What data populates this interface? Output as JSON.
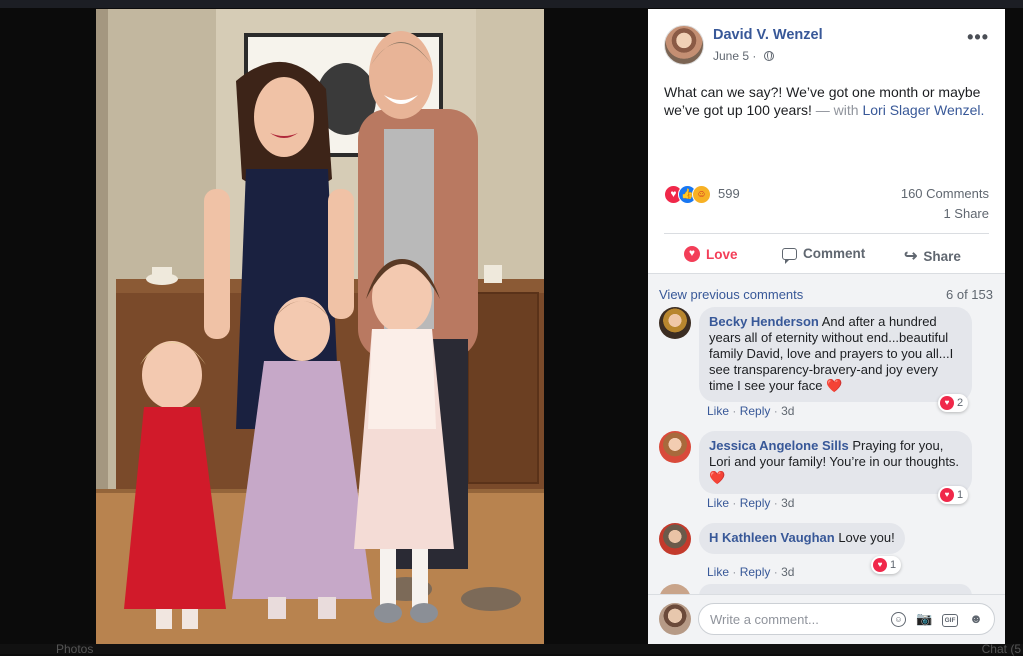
{
  "bottom": {
    "photos_label": "Photos",
    "chat_label": "Chat (5"
  },
  "post": {
    "author": "David V. Wenzel",
    "date": "June 5 ·",
    "menu": "•••",
    "text_main": "What can we say?! We’ve got one month or maybe we’ve got up 100 years!",
    "text_with": "— with",
    "text_tagged": "Lori Slager Wenzel.",
    "reaction_count": "599",
    "comments_count": "160 Comments",
    "shares_count": "1 Share"
  },
  "actions": {
    "love": "Love",
    "comment": "Comment",
    "share": "Share"
  },
  "comments_section": {
    "view_previous": "View previous comments",
    "page_count": "6 of 153",
    "comments": [
      {
        "name": "Becky Henderson",
        "text": "And after a hundred years all of eternity without end...beautiful family David, love and prayers to you all...I see transparency-bravery-and joy every time I see your face",
        "like": "Like",
        "reply": "Reply",
        "time": "3d",
        "reactions": "2"
      },
      {
        "name": "Jessica Angelone Sills",
        "text": "Praying for you, Lori and your family! You’re in our thoughts.",
        "like": "Like",
        "reply": "Reply",
        "time": "3d",
        "reactions": "1"
      },
      {
        "name": "H Kathleen Vaughan",
        "text": "Love you!",
        "like": "Like",
        "reply": "Reply",
        "time": "3d",
        "reactions": "1"
      }
    ]
  },
  "composer": {
    "placeholder": "Write a comment...",
    "gif_label": "GIF"
  },
  "colors": {
    "link": "#385898",
    "love": "#f33e58",
    "panel_bg": "#ffffff",
    "comment_bg": "#e4e6eb"
  },
  "icons": [
    "globe-icon",
    "more-icon",
    "love-reaction-icon",
    "like-reaction-icon",
    "care-reaction-icon",
    "comment-icon",
    "share-icon",
    "emoji-icon",
    "camera-icon",
    "gif-icon",
    "sticker-icon"
  ]
}
